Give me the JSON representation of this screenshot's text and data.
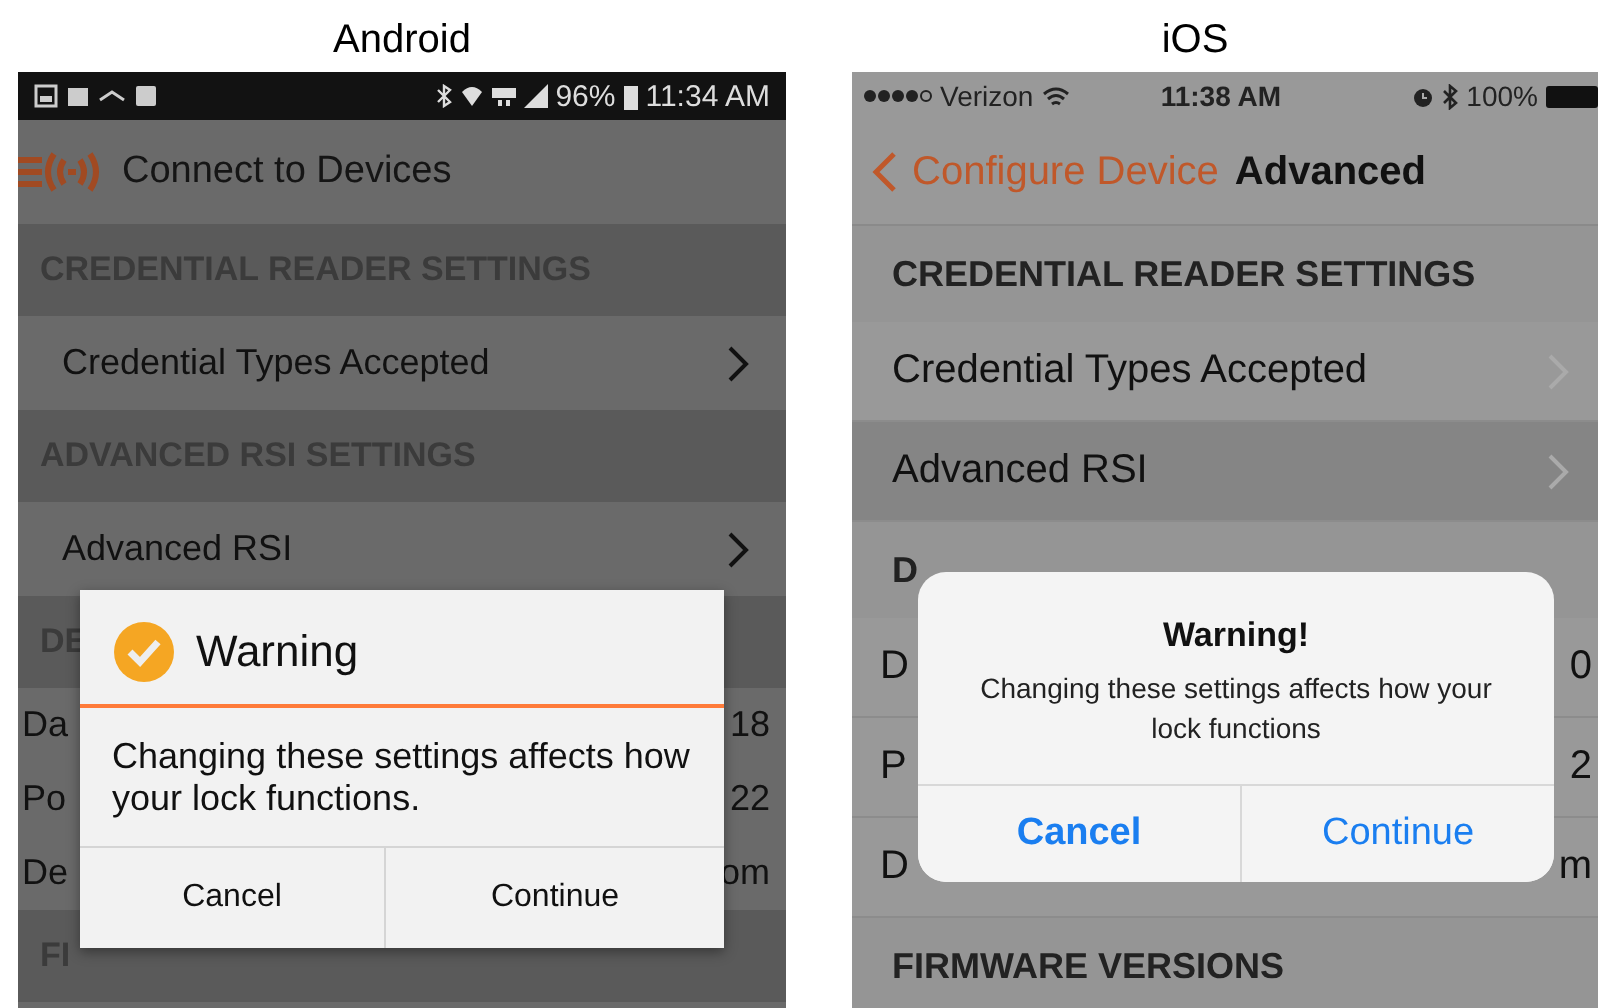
{
  "android": {
    "caption": "Android",
    "status_bar": {
      "battery": "96%",
      "time": "11:34 AM"
    },
    "toolbar": {
      "title": "Connect to Devices"
    },
    "list": [
      {
        "kind": "header",
        "text": "CREDENTIAL READER SETTINGS"
      },
      {
        "kind": "link",
        "text": "Credential Types Accepted"
      },
      {
        "kind": "header",
        "text": "ADVANCED RSI SETTINGS"
      },
      {
        "kind": "link",
        "text": "Advanced RSI"
      },
      {
        "kind": "header",
        "text": "DE"
      },
      {
        "kind": "value",
        "text": "Da",
        "value": "18"
      },
      {
        "kind": "value",
        "text": "Po",
        "value": "22"
      },
      {
        "kind": "value",
        "text": "De",
        "value": "om"
      },
      {
        "kind": "header",
        "text": "FI"
      }
    ],
    "dialog": {
      "title": "Warning",
      "message": "Changing these settings affects how your lock functions.",
      "buttons": [
        "Cancel",
        "Continue"
      ]
    }
  },
  "ios": {
    "caption": "iOS",
    "status_bar": {
      "carrier": "Verizon",
      "time": "11:38 AM",
      "battery": "100%"
    },
    "nav": {
      "back": "Configure Device",
      "title": "Advanced"
    },
    "list": [
      {
        "kind": "header",
        "text": "CREDENTIAL READER SETTINGS"
      },
      {
        "kind": "link",
        "text": "Credential Types Accepted",
        "selected": false
      },
      {
        "kind": "link",
        "text": "Advanced RSI",
        "selected": true
      },
      {
        "kind": "header",
        "text": "D"
      },
      {
        "kind": "value",
        "text": "D",
        "value": "0"
      },
      {
        "kind": "value",
        "text": "P",
        "value": "2"
      },
      {
        "kind": "value",
        "text": "D",
        "value": "m"
      },
      {
        "kind": "header",
        "text": "FIRMWARE VERSIONS"
      }
    ],
    "dialog": {
      "title": "Warning!",
      "message": "Changing these settings affects how your lock functions",
      "buttons": [
        "Cancel",
        "Continue"
      ]
    }
  }
}
